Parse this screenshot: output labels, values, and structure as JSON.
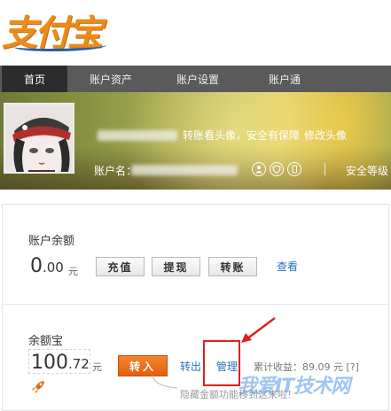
{
  "logo": {
    "text": "支付宝"
  },
  "nav": {
    "items": [
      {
        "label": "首页",
        "active": true
      },
      {
        "label": "账户资产",
        "active": false
      },
      {
        "label": "账户设置",
        "active": false
      },
      {
        "label": "账户通",
        "active": false
      }
    ]
  },
  "profile": {
    "avatar_prompt": "转账看头像，安全有保障",
    "change_avatar": "修改头像",
    "account_name_label": "账户名：",
    "security_level_label": "安全等级",
    "icons": [
      "user-icon",
      "shield-icon",
      "phone-icon"
    ]
  },
  "balance": {
    "title": "账户余额",
    "amount_int": "0",
    "amount_dec": ".00",
    "unit": "元",
    "buttons": {
      "recharge": "充值",
      "withdraw": "提现",
      "transfer": "转账"
    },
    "view_link": "查看"
  },
  "yuebao": {
    "title": "余额宝",
    "amount_int": "100",
    "amount_dec": ".72",
    "unit": "元",
    "transfer_in": "转入",
    "transfer_out": "转出",
    "manage": "管理",
    "cumulative_label": "累计收益：",
    "cumulative_value": "89.09",
    "cumulative_unit": "元",
    "help": "[?]",
    "notice": "隐藏金额功能移到这来啦！"
  },
  "watermark": "我爱IT技术网"
}
